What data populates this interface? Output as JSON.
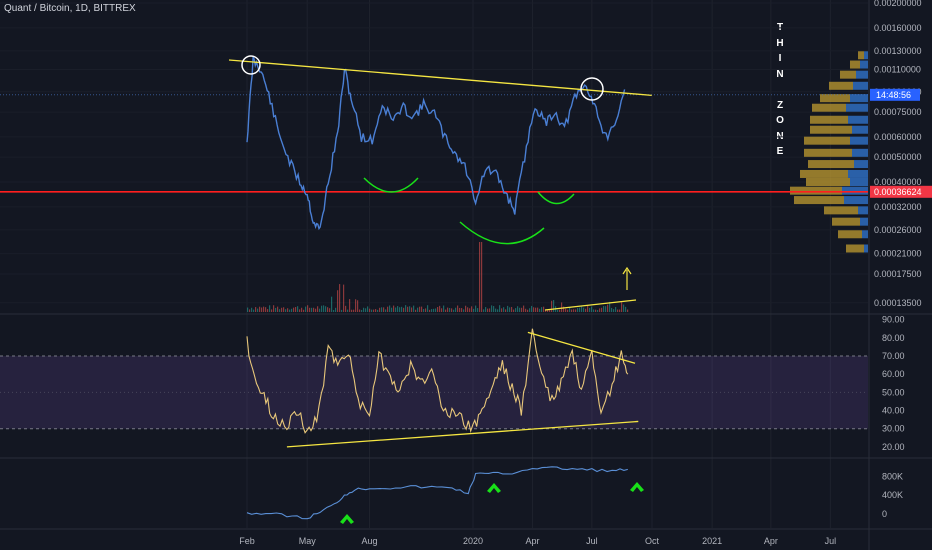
{
  "header": {
    "title": "Quant / Bitcoin, 1D, BITTREX"
  },
  "annotation": {
    "letters": [
      "T",
      "H",
      "I",
      "N",
      "",
      "Z",
      "O",
      "N",
      "E"
    ]
  },
  "price_axis": {
    "labels": [
      "0.00200000",
      "0.00160000",
      "0.00130000",
      "0.00110000",
      "0.00090000",
      "0.00075000",
      "0.00060000",
      "0.00050000",
      "0.00040000",
      "0.00032000",
      "0.00026000",
      "0.00021000",
      "0.00017500",
      "0.00013500"
    ],
    "price_tag": "0.00036624",
    "price_tag_color": "#f23645",
    "countdown": "14:48:56",
    "countdown_color": "#2962ff"
  },
  "rsi_axis": {
    "labels": [
      "90.00",
      "80.00",
      "70.00",
      "60.00",
      "50.00",
      "40.00",
      "30.00",
      "20.00"
    ]
  },
  "volume_axis": {
    "labels": [
      "800K",
      "400K",
      "0"
    ]
  },
  "time_axis": {
    "labels": [
      "Feb",
      "May",
      "Aug",
      "2020",
      "Apr",
      "Jul",
      "Oct",
      "2021",
      "Apr",
      "Jul"
    ]
  },
  "colors": {
    "price": "#4a7fd4",
    "trend": "#f5e642",
    "support": "#ff1e1e",
    "cup": "#19e019",
    "rsi": "#e8c77a",
    "obv": "#5a8fd6",
    "arrow": "#19e019"
  },
  "chart_data": [
    {
      "type": "line",
      "id": "price",
      "x": [
        "2019-02-01",
        "2019-02-10",
        "2019-02-20",
        "2019-03-05",
        "2019-03-20",
        "2019-04-05",
        "2019-04-20",
        "2019-05-01",
        "2019-05-10",
        "2019-05-20",
        "2019-06-01",
        "2019-06-15",
        "2019-06-25",
        "2019-07-05",
        "2019-07-20",
        "2019-08-05",
        "2019-08-20",
        "2019-09-05",
        "2019-09-20",
        "2019-10-05",
        "2019-10-20",
        "2019-11-05",
        "2019-11-20",
        "2019-12-05",
        "2019-12-20",
        "2020-01-05",
        "2020-01-20",
        "2020-02-05",
        "2020-02-20",
        "2020-03-05",
        "2020-03-20",
        "2020-04-05",
        "2020-04-20",
        "2020-05-05",
        "2020-05-20",
        "2020-06-05",
        "2020-06-20",
        "2020-07-05",
        "2020-07-20",
        "2020-08-05",
        "2020-08-20"
      ],
      "y": [
        0.00058,
        0.0012,
        0.00112,
        0.00088,
        0.00062,
        0.00048,
        0.0004,
        0.00036,
        0.00028,
        0.00026,
        0.0004,
        0.00062,
        0.0011,
        0.00085,
        0.0006,
        0.00058,
        0.0008,
        0.0007,
        0.00078,
        0.00072,
        0.0008,
        0.00074,
        0.0006,
        0.00052,
        0.00046,
        0.00034,
        0.00045,
        0.00043,
        0.00036,
        0.00031,
        0.0005,
        0.0008,
        0.00068,
        0.00075,
        0.00065,
        0.00085,
        0.00095,
        0.00082,
        0.0006,
        0.00064,
        0.00092
      ],
      "trendline": [
        [
          "2019-02-01",
          0.00122
        ],
        [
          "2020-08-31",
          0.00092
        ]
      ],
      "support": 0.00036624,
      "ylim": [
        0.00013,
        0.002
      ]
    },
    {
      "type": "line",
      "id": "rsi",
      "x": [
        "2019-02-01",
        "2019-02-15",
        "2019-03-01",
        "2019-03-15",
        "2019-04-01",
        "2019-04-15",
        "2019-05-01",
        "2019-05-15",
        "2019-06-01",
        "2019-06-15",
        "2019-07-01",
        "2019-07-15",
        "2019-08-01",
        "2019-08-15",
        "2019-09-01",
        "2019-09-15",
        "2019-10-01",
        "2019-10-15",
        "2019-11-01",
        "2019-11-15",
        "2019-12-01",
        "2019-12-15",
        "2020-01-01",
        "2020-01-15",
        "2020-02-01",
        "2020-02-15",
        "2020-03-01",
        "2020-03-15",
        "2020-04-01",
        "2020-04-15",
        "2020-05-01",
        "2020-05-15",
        "2020-06-01",
        "2020-06-15",
        "2020-07-01",
        "2020-07-15",
        "2020-08-01",
        "2020-08-15",
        "2020-08-25"
      ],
      "y": [
        78,
        55,
        45,
        35,
        33,
        40,
        28,
        35,
        72,
        68,
        72,
        45,
        40,
        70,
        60,
        50,
        65,
        55,
        62,
        45,
        38,
        35,
        30,
        40,
        55,
        66,
        52,
        40,
        83,
        60,
        45,
        55,
        72,
        50,
        70,
        35,
        55,
        70,
        60
      ],
      "trendlines": [
        [
          [
            "2019-04-01",
            20
          ],
          [
            "2020-09-10",
            34
          ]
        ],
        [
          [
            "2020-03-25",
            83
          ],
          [
            "2020-09-05",
            66
          ]
        ]
      ],
      "bands": [
        30,
        70
      ],
      "ylim": [
        15,
        92
      ]
    },
    {
      "type": "area",
      "id": "obv",
      "x": [
        "2019-02-01",
        "2019-03-01",
        "2019-04-01",
        "2019-05-01",
        "2019-05-20",
        "2019-06-10",
        "2019-06-25",
        "2019-07-10",
        "2019-08-01",
        "2019-09-01",
        "2019-10-01",
        "2019-11-01",
        "2019-12-01",
        "2019-12-25",
        "2020-01-05",
        "2020-02-01",
        "2020-03-01",
        "2020-04-01",
        "2020-05-01",
        "2020-06-01",
        "2020-07-01",
        "2020-08-01",
        "2020-08-25"
      ],
      "y": [
        20000,
        10000,
        -30000,
        -100000,
        50000,
        200000,
        400000,
        520000,
        550000,
        560000,
        580000,
        570000,
        560000,
        440000,
        850000,
        860000,
        870000,
        980000,
        980000,
        960000,
        940000,
        920000,
        950000
      ],
      "ylim": [
        -300000,
        1150000
      ]
    }
  ]
}
